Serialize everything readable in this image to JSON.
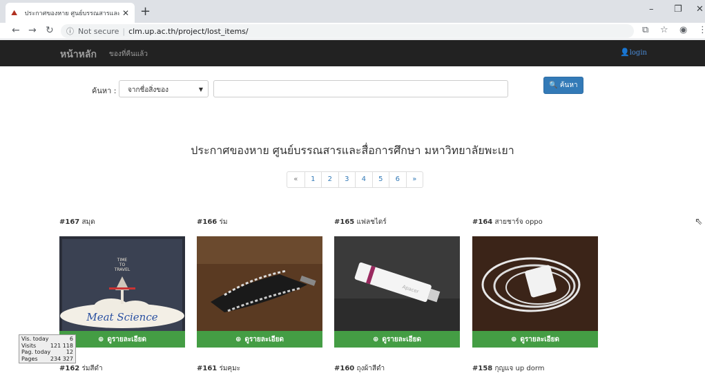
{
  "browser": {
    "tab_title": "ประกาศของหาย ศูนย์บรรณสารและสื่อ",
    "tab_close": "✕",
    "new_tab": "+",
    "not_secure": "Not secure",
    "url": "clm.up.ac.th/project/lost_items/"
  },
  "navbar": {
    "brand": "หน้าหลัก",
    "link_returned": "ของที่คืนแล้ว",
    "login": "login"
  },
  "search": {
    "label": "ค้นหา :",
    "select_value": "จากชื่อสิ่งของ",
    "input_value": "",
    "button_label": "ค้นหา"
  },
  "heading": "ประกาศของหาย ศูนย์บรรณสารและสื่อการศึกษา มหาวิทยาลัยพะเยา",
  "pagination": [
    "«",
    "1",
    "2",
    "3",
    "4",
    "5",
    "6",
    "»"
  ],
  "items": [
    {
      "id": "#167",
      "name": "สมุด",
      "button": "ดูรายละเอียด"
    },
    {
      "id": "#166",
      "name": "ร่ม",
      "button": "ดูรายละเอียด"
    },
    {
      "id": "#165",
      "name": "แฟลชไดร์",
      "button": "ดูรายละเอียด"
    },
    {
      "id": "#164",
      "name": "สายชาร์จ oppo",
      "button": "ดูรายละเอียด"
    }
  ],
  "items_next": [
    {
      "id": "#162",
      "name": "ร่มสีดำ"
    },
    {
      "id": "#161",
      "name": "ร่มคุมะ"
    },
    {
      "id": "#160",
      "name": "ถุงผ้าสีดำ"
    },
    {
      "id": "#158",
      "name": "กุญแจ up dorm"
    }
  ],
  "book_cover": {
    "line1": "TIME",
    "line2": "TO",
    "line3": "TRAVEL",
    "handwriting": "Meat Science"
  },
  "flash_brand": "Apacer",
  "stats": [
    {
      "label": "Vis. today",
      "value": "6"
    },
    {
      "label": "Visits",
      "value": "121 118"
    },
    {
      "label": "Pag. today",
      "value": "12"
    },
    {
      "label": "Pages",
      "value": "234 327"
    }
  ],
  "colors": {
    "navbar": "#222222",
    "primary": "#337ab7",
    "success": "#449d44"
  }
}
